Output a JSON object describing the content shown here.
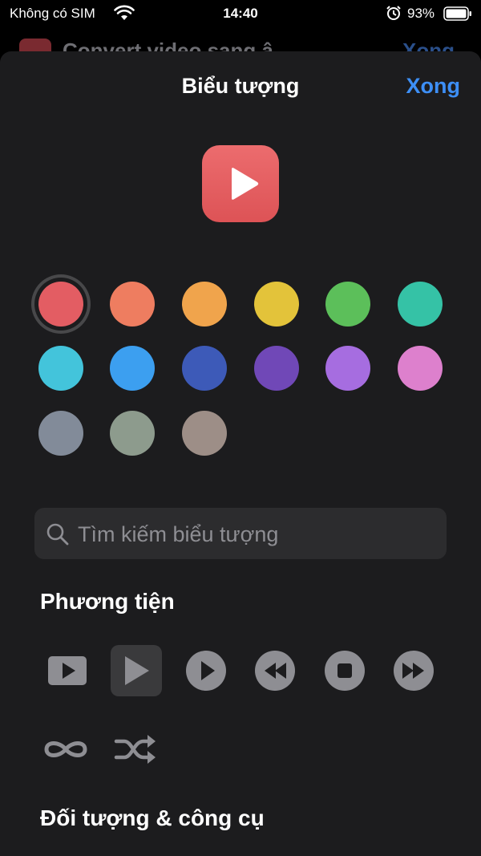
{
  "status_bar": {
    "carrier": "Không có SIM",
    "time": "14:40",
    "battery": "93%"
  },
  "background": {
    "title": "Convert video sang â",
    "done": "Xong"
  },
  "sheet": {
    "title": "Biểu tượng",
    "done_label": "Xong",
    "preview": {
      "icon": "play-icon",
      "color": "#e85f62"
    },
    "colors": [
      {
        "name": "red",
        "hex": "#e35d63",
        "selected": true
      },
      {
        "name": "dark-orange",
        "hex": "#ee7d60"
      },
      {
        "name": "orange",
        "hex": "#f0a44c"
      },
      {
        "name": "yellow",
        "hex": "#e3c33a"
      },
      {
        "name": "green",
        "hex": "#5cbf5a"
      },
      {
        "name": "teal",
        "hex": "#35c2a6"
      },
      {
        "name": "light-blue",
        "hex": "#43c4db"
      },
      {
        "name": "blue",
        "hex": "#3c9ff0"
      },
      {
        "name": "dark-blue",
        "hex": "#3d5ab8"
      },
      {
        "name": "violet",
        "hex": "#7048b7"
      },
      {
        "name": "purple",
        "hex": "#a66de0"
      },
      {
        "name": "pink",
        "hex": "#dd80cd"
      },
      {
        "name": "dark-gray",
        "hex": "#828b99"
      },
      {
        "name": "gray-green",
        "hex": "#8d9b8d"
      },
      {
        "name": "taupe",
        "hex": "#9d8e87"
      }
    ],
    "search": {
      "placeholder": "Tìm kiếm biểu tượng"
    },
    "sections": {
      "media": {
        "title": "Phương tiện",
        "glyphs": [
          "play-rectangle-icon",
          "play-icon",
          "play-circle-icon",
          "backward-circle-icon",
          "stop-circle-icon",
          "forward-circle-icon",
          "infinity-icon",
          "shuffle-icon"
        ]
      },
      "objects": {
        "title": "Đối tượng & công cụ"
      }
    }
  }
}
